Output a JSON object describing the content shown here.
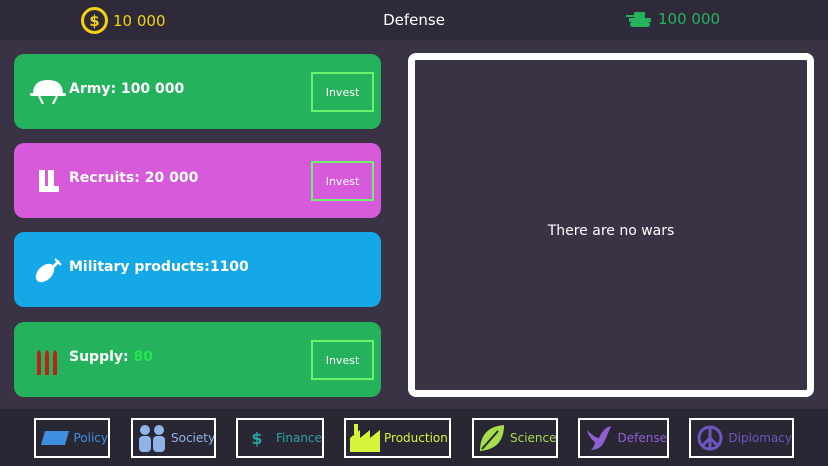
{
  "header": {
    "coins": "10 000",
    "title": "Defense",
    "army": "100 000"
  },
  "cards": [
    {
      "label": "Army: 100 000",
      "button": "Invest",
      "icon": "helmet-icon"
    },
    {
      "label": "Recruits: 20 000",
      "button": "Invest",
      "icon": "boots-icon"
    },
    {
      "label": "Military products:1100",
      "icon": "bomb-icon"
    },
    {
      "label": "Supply:",
      "value": "80",
      "button": "Invest",
      "icon": "ammo-icon"
    }
  ],
  "wars": {
    "message": "There are no wars"
  },
  "nav": [
    {
      "label": "Policy",
      "color": "#3e8fe0",
      "icon": "flag-icon"
    },
    {
      "label": "Society",
      "color": "#8fb5e8",
      "icon": "people-icon"
    },
    {
      "label": "Finance",
      "color": "#2aa3a3",
      "icon": "dollar-icon"
    },
    {
      "label": "Production",
      "color": "#d4f53a",
      "icon": "factory-icon"
    },
    {
      "label": "Science",
      "color": "#a6dd4a",
      "icon": "leaf-icon"
    },
    {
      "label": "Defense",
      "color": "#8e5fd0",
      "icon": "dove-icon"
    },
    {
      "label": "Diplomacy",
      "color": "#6f55c0",
      "icon": "peace-icon"
    }
  ],
  "colors": {
    "gold": "#f5d312",
    "green": "#24b35c",
    "pink": "#d65ad9",
    "blue": "#14a8e6",
    "supply_value": "#22e84e"
  }
}
